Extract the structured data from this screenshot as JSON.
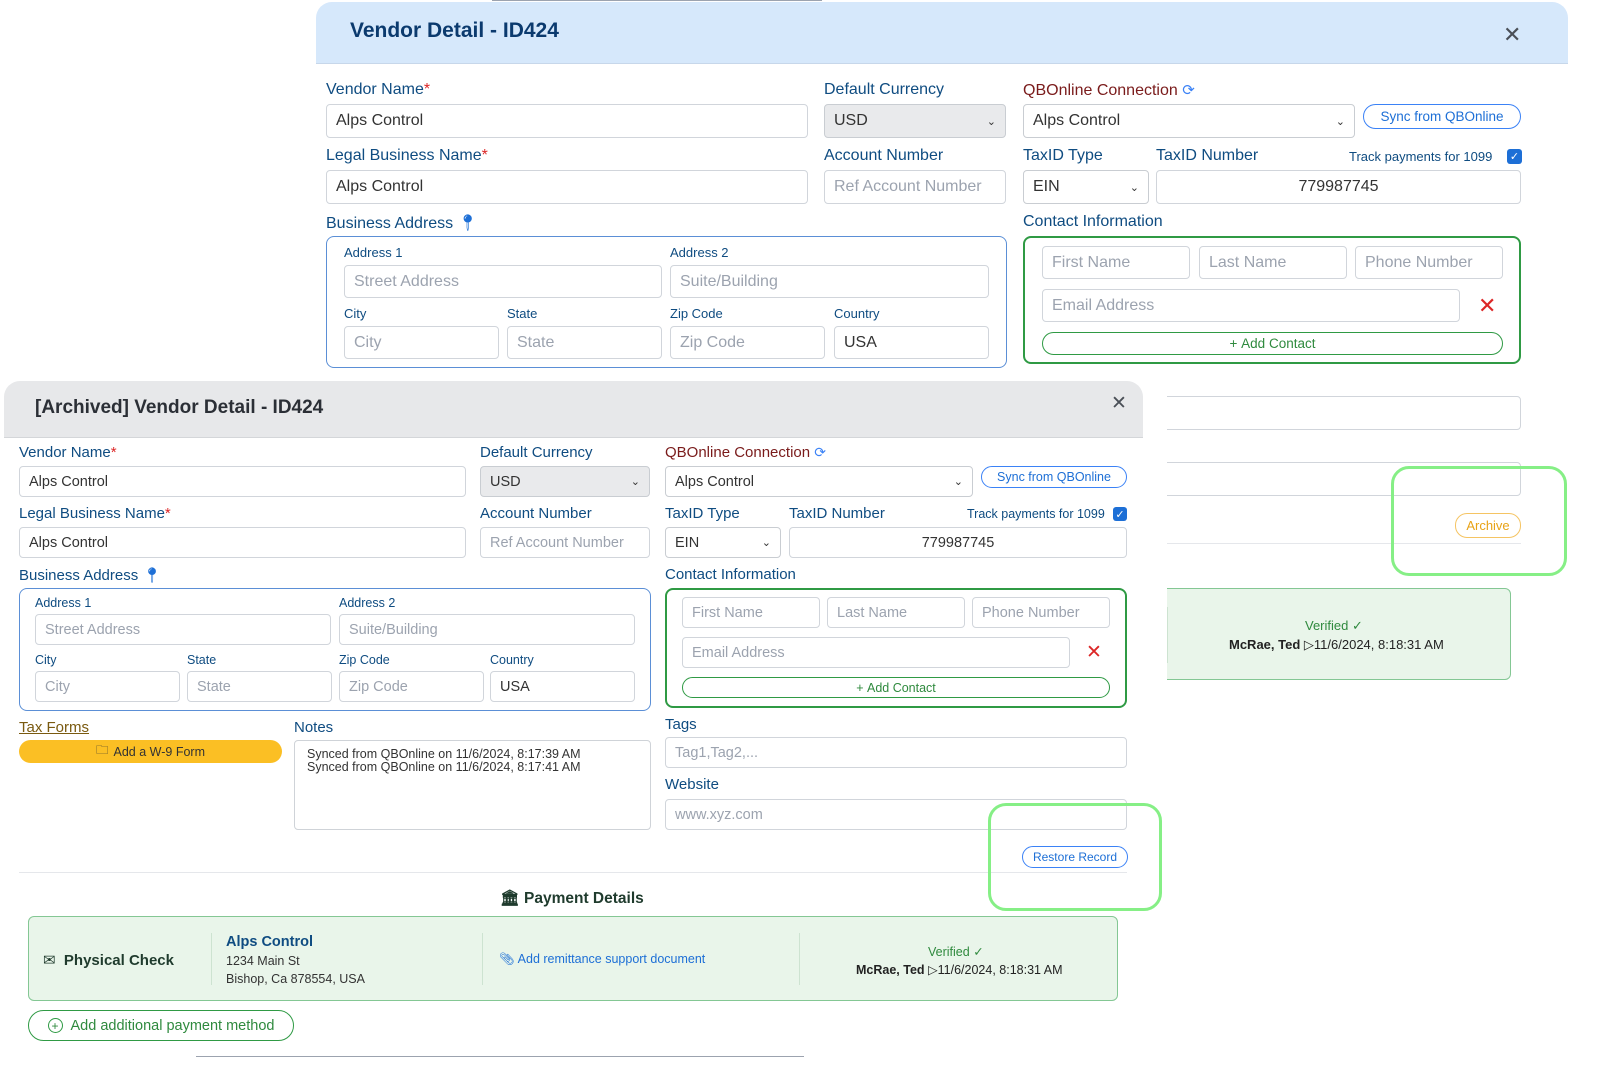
{
  "background_modal": {
    "title": "Vendor Detail - ID424",
    "vendor_name_label": "Vendor Name",
    "vendor_name_value": "Alps  Control",
    "default_currency_label": "Default Currency",
    "default_currency_value": "USD",
    "qbo_connection_label": "QBOnline Connection",
    "qbo_connection_value": "Alps Control",
    "sync_button": "Sync from QBOnline",
    "legal_name_label": "Legal Business Name",
    "legal_name_value": "Alps  Control",
    "account_number_label": "Account Number",
    "account_number_placeholder": "Ref Account Number",
    "taxid_type_label": "TaxID Type",
    "taxid_type_value": "EIN",
    "taxid_number_label": "TaxID Number",
    "taxid_number_value": "779987745",
    "track_1099_label": "Track payments for 1099",
    "business_address_label": "Business Address",
    "address1_label": "Address 1",
    "address1_placeholder": "Street Address",
    "address2_label": "Address 2",
    "address2_placeholder": "Suite/Building",
    "city_label": "City",
    "city_placeholder": "City",
    "state_label": "State",
    "state_placeholder": "State",
    "zip_label": "Zip Code",
    "zip_placeholder": "Zip Code",
    "country_label": "Country",
    "country_value": "USA",
    "contact_info_label": "Contact Information",
    "first_name_placeholder": "First Name",
    "last_name_placeholder": "Last Name",
    "phone_placeholder": "Phone Number",
    "email_placeholder": "Email Address",
    "add_contact": "Add Contact",
    "archive_button": "Archive",
    "verified_label": "Verified",
    "verified_by": "McRae, Ted",
    "verified_at": "11/6/2024, 8:18:31 AM"
  },
  "archived_modal": {
    "title": "[Archived] Vendor Detail - ID424",
    "vendor_name_label": "Vendor Name",
    "vendor_name_value": "Alps  Control",
    "default_currency_label": "Default Currency",
    "default_currency_value": "USD",
    "qbo_connection_label": "QBOnline Connection",
    "qbo_connection_value": "Alps Control",
    "sync_button": "Sync from QBOnline",
    "legal_name_label": "Legal Business Name",
    "legal_name_value": "Alps  Control",
    "account_number_label": "Account Number",
    "account_number_placeholder": "Ref Account Number",
    "taxid_type_label": "TaxID Type",
    "taxid_type_value": "EIN",
    "taxid_number_label": "TaxID Number",
    "taxid_number_value": "779987745",
    "track_1099_label": "Track payments for 1099",
    "business_address_label": "Business Address",
    "address1_label": "Address 1",
    "address1_placeholder": "Street Address",
    "address2_label": "Address 2",
    "address2_placeholder": "Suite/Building",
    "city_label": "City",
    "city_placeholder": "City",
    "state_label": "State",
    "state_placeholder": "State",
    "zip_label": "Zip Code",
    "zip_placeholder": "Zip Code",
    "country_label": "Country",
    "country_value": "USA",
    "contact_info_label": "Contact Information",
    "first_name_placeholder": "First Name",
    "last_name_placeholder": "Last Name",
    "phone_placeholder": "Phone Number",
    "email_placeholder": "Email Address",
    "add_contact": "Add Contact",
    "tax_forms_label": "Tax Forms",
    "add_w9_button": "Add a W-9 Form",
    "notes_label": "Notes",
    "notes_lines": [
      "Synced from QBOnline on 11/6/2024, 8:17:39 AM",
      "Synced from QBOnline on 11/6/2024, 8:17:41 AM"
    ],
    "tags_label": "Tags",
    "tags_placeholder": "Tag1,Tag2,...",
    "website_label": "Website",
    "website_placeholder": "www.xyz.com",
    "restore_button": "Restore Record",
    "payment_details_title": "Payment Details",
    "payment": {
      "method": "Physical Check",
      "payee": "Alps Control",
      "address_line1": "1234 Main St",
      "address_line2": "Bishop, Ca 878554, USA",
      "remittance_link": "Add remittance support document",
      "verified_label": "Verified",
      "verified_by": "McRae, Ted",
      "verified_at": "11/6/2024, 8:18:31 AM"
    },
    "add_payment_method": "Add additional payment method"
  },
  "colors": {
    "active_header": "#d6e8fb",
    "archived_header": "#e7e8ea",
    "highlight": "#86ef86",
    "verified_green": "#2f8a3e",
    "archive_amber": "#e8a317"
  }
}
